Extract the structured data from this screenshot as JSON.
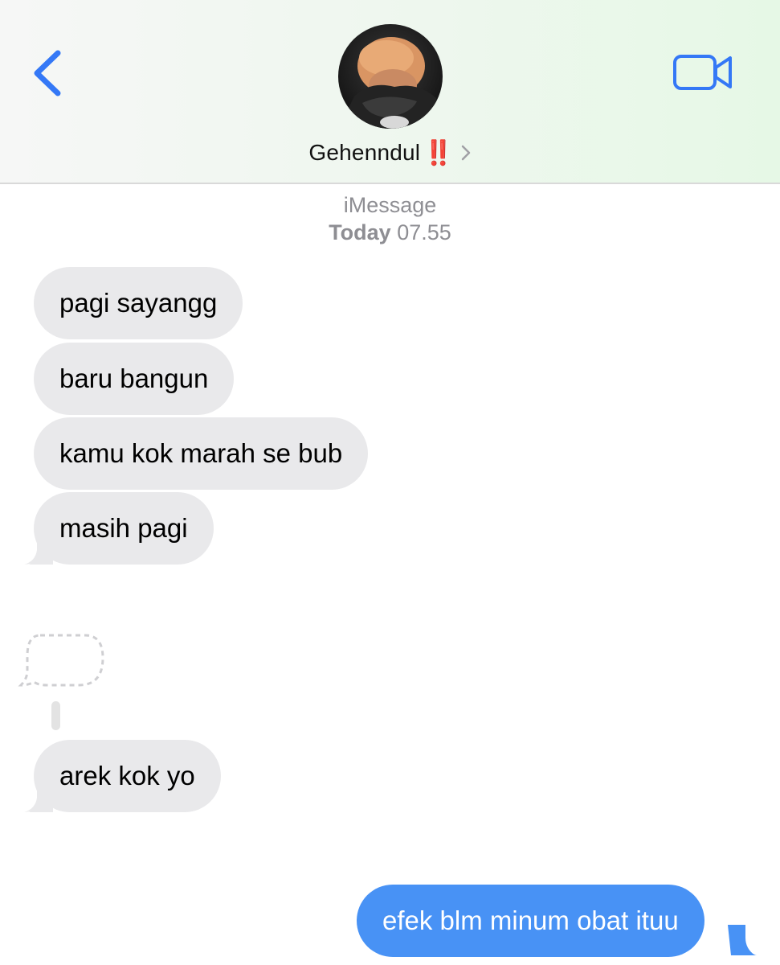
{
  "header": {
    "contact_name": "Gehenndul",
    "contact_emoji": "‼️",
    "back_icon": "chevron-left-icon",
    "video_icon": "video-camera-icon",
    "accent_color": "#3478f6"
  },
  "thread": {
    "service": "iMessage",
    "day": "Today",
    "time": "07.55"
  },
  "messages": [
    {
      "direction": "incoming",
      "text": "pagi sayangg"
    },
    {
      "direction": "incoming",
      "text": "baru bangun"
    },
    {
      "direction": "incoming",
      "text": "kamu kok marah se bub"
    },
    {
      "direction": "incoming",
      "text": "masih pagi"
    },
    {
      "direction": "incoming",
      "text": "arek kok yo"
    },
    {
      "direction": "outgoing",
      "text": "efek blm minum obat ituu"
    }
  ],
  "colors": {
    "incoming_bubble": "#e9e9eb",
    "outgoing_bubble": "#4892f5",
    "meta_text": "#8e8e93"
  }
}
